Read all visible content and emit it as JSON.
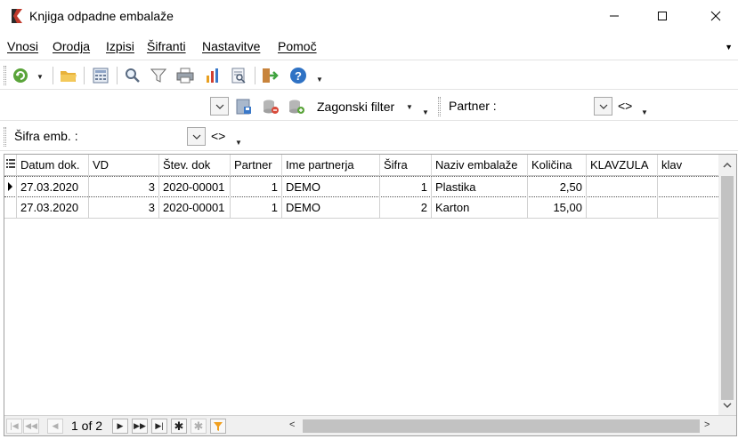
{
  "window": {
    "title": "Knjiga odpadne embalaže"
  },
  "menu": {
    "items": [
      {
        "label": "Vnosi"
      },
      {
        "label": "Orodja"
      },
      {
        "label": "Izpisi"
      },
      {
        "label": "Šifranti"
      },
      {
        "label": "Nastavitve"
      },
      {
        "label": "Pomoč"
      }
    ]
  },
  "toolbar": {
    "icons": [
      "refresh-icon",
      "open-folder-icon",
      "calculator-icon",
      "search-icon",
      "filter-icon",
      "print-icon",
      "chart-icon",
      "report-icon",
      "exit-icon",
      "help-icon"
    ]
  },
  "filters": {
    "zagonski_filter_label": "Zagonski filter",
    "partner_label": "Partner :",
    "partner_operator": "<>",
    "sifra_label": "Šifra emb. :",
    "sifra_operator": "<>"
  },
  "grid": {
    "columns": [
      "Datum dok.",
      "VD",
      "Štev. dok",
      "Partner",
      "Ime partnerja",
      "Šifra",
      "Naziv embalaže",
      "Količina",
      "KLAVZULA",
      "klav"
    ],
    "rows": [
      {
        "datum": "27.03.2020",
        "vd": "3",
        "stev": "2020-00001",
        "partner": "1",
        "ime": "DEMO",
        "sifra": "1",
        "naziv": "Plastika",
        "kolicina": "2,50",
        "klavzula": "",
        "klav": ""
      },
      {
        "datum": "27.03.2020",
        "vd": "3",
        "stev": "2020-00001",
        "partner": "1",
        "ime": "DEMO",
        "sifra": "2",
        "naziv": "Karton",
        "kolicina": "15,00",
        "klavzula": "",
        "klav": ""
      }
    ]
  },
  "navigator": {
    "page_label": "1 of 2"
  },
  "colors": {
    "accent_green": "#5aa43a",
    "folder_yellow": "#e8b23a",
    "help_blue": "#2f72c4",
    "filter_orange": "#f0a020"
  }
}
